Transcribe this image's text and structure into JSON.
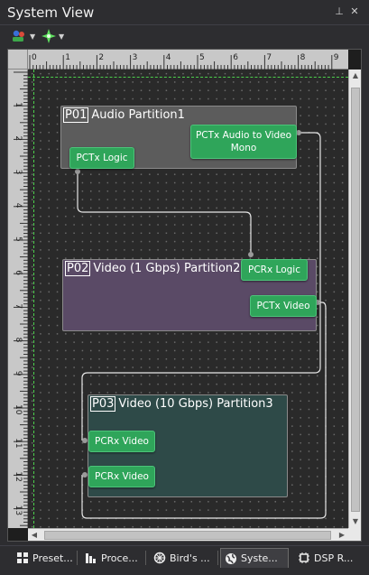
{
  "panel": {
    "title": "System View",
    "pin_glyph": "⊥",
    "close_glyph": "✕"
  },
  "toolbar": {
    "tools": [
      {
        "icon": "shapes-color-icon"
      },
      {
        "icon": "green-star-icon"
      }
    ],
    "caret": "▼"
  },
  "ruler": {
    "top_labels": [
      "0",
      "1",
      "2",
      "3",
      "4",
      "5",
      "6",
      "7",
      "8",
      "9"
    ],
    "left_labels": [
      "1",
      "2",
      "3",
      "4",
      "5",
      "6",
      "7",
      "8",
      "9",
      "10",
      "11",
      "12",
      "13"
    ]
  },
  "partitions": [
    {
      "id": "P01",
      "name": "Audio Partition1",
      "color": "#5c5c5c",
      "nodes": [
        "PCTx Logic",
        "PCTx Audio to Video Mono"
      ]
    },
    {
      "id": "P02",
      "name": "Video (1 Gbps) Partition2",
      "color": "#5a4a66",
      "nodes": [
        "PCRx Logic",
        "PCTx Video"
      ]
    },
    {
      "id": "P03",
      "name": "Video (10 Gbps) Partition3",
      "color": "#2e4a48",
      "nodes": [
        "PCRx Video",
        "PCRx Video"
      ]
    }
  ],
  "tabs": [
    {
      "label": "Preset...",
      "icon": "grid-icon"
    },
    {
      "label": "Proce...",
      "icon": "bar-chart-icon"
    },
    {
      "label": "Bird's ...",
      "icon": "bird-eye-icon"
    },
    {
      "label": "Syste...",
      "icon": "globe-icon",
      "active": true
    },
    {
      "label": "DSP R...",
      "icon": "chip-icon"
    }
  ],
  "colors": {
    "node_green": "#2fa55a",
    "guide_green": "#4ccf4c",
    "wire": "#e6e6e6"
  }
}
